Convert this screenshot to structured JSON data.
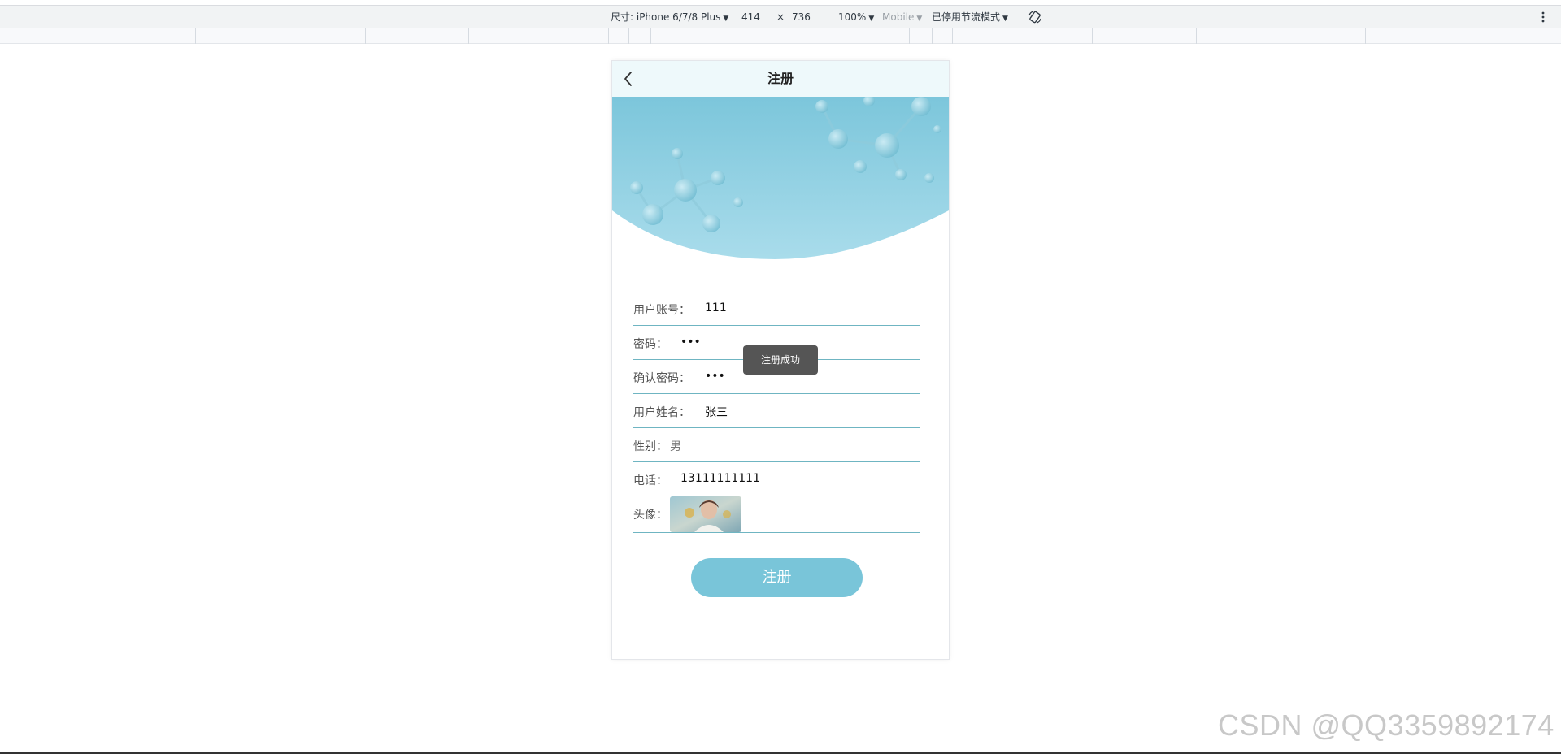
{
  "devtools": {
    "dimensions_label": "尺寸: iPhone 6/7/8 Plus",
    "width": "414",
    "times": "×",
    "height": "736",
    "zoom": "100%",
    "device_type": "Mobile",
    "throttle": "已停用节流模式",
    "rotate_icon": "rotate-icon",
    "more_icon": "kebab-icon"
  },
  "nav": {
    "back_icon": "chevron-left-icon",
    "title": "注册"
  },
  "form": {
    "fields": [
      {
        "label": "用户账号：",
        "value": "111"
      },
      {
        "label": "密码：",
        "value": "•••"
      },
      {
        "label": "确认密码：",
        "value": "•••"
      },
      {
        "label": "用户姓名：",
        "value": "张三"
      },
      {
        "label": "性别：",
        "value": "男"
      },
      {
        "label": "电话：",
        "value": "13111111111"
      },
      {
        "label": "头像："
      }
    ],
    "submit_label": "注册"
  },
  "toast": "注册成功",
  "watermark": "CSDN @QQ3359892174",
  "colors": {
    "accent": "#79c5d9",
    "field_border": "#6fb5c2",
    "toast_bg": "#555555"
  }
}
